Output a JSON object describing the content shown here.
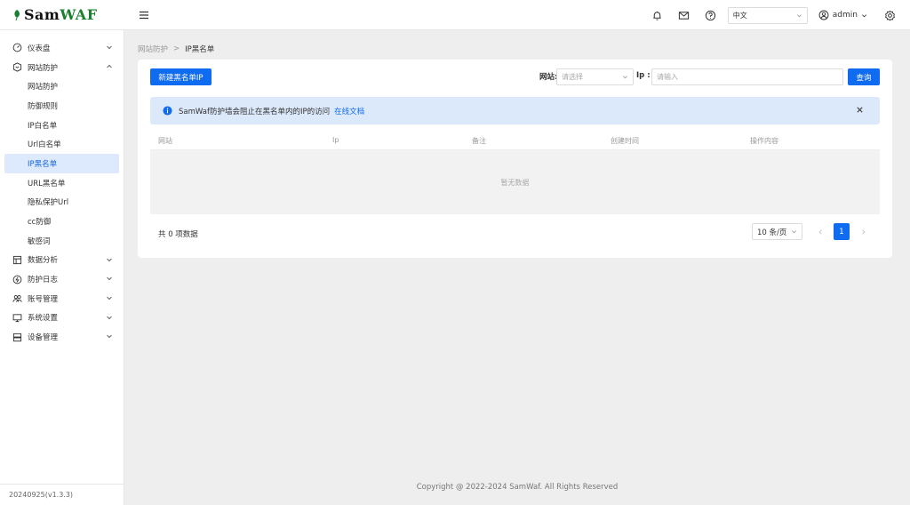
{
  "brand": {
    "name_part1": "Sam",
    "name_part2": "WAF"
  },
  "header": {
    "language": "中文",
    "user": "admin"
  },
  "sidebar": {
    "groups": [
      {
        "label": "仪表盘",
        "icon": "dashboard-icon"
      },
      {
        "label": "网站防护",
        "icon": "shield-icon"
      },
      {
        "label": "数据分析",
        "icon": "chart-icon"
      },
      {
        "label": "防护日志",
        "icon": "log-icon"
      },
      {
        "label": "账号管理",
        "icon": "users-icon"
      },
      {
        "label": "系统设置",
        "icon": "monitor-icon"
      },
      {
        "label": "设备管理",
        "icon": "server-icon"
      }
    ],
    "sub_items": [
      "网站防护",
      "防御规则",
      "IP白名单",
      "Url白名单",
      "IP黑名单",
      "URL黑名单",
      "隐私保护Url",
      "cc防御",
      "敏感词"
    ],
    "active_sub": "IP黑名单",
    "version": "20240925(v1.3.3)"
  },
  "breadcrumb": {
    "parent": "网站防护",
    "sep": ">",
    "current": "IP黑名单"
  },
  "toolbar": {
    "new_button": "新建黑名单IP",
    "site_label": "网站:",
    "site_placeholder": "请选择",
    "ip_label": "Ip :",
    "ip_placeholder": "请输入",
    "query_button": "查询"
  },
  "alert": {
    "message": "SamWaf防护墙会阻止在黑名单内的IP的访问",
    "link": "在线文档"
  },
  "table": {
    "columns": [
      "网站",
      "Ip",
      "备注",
      "创建时间",
      "操作内容"
    ],
    "empty_text": "暂无数据"
  },
  "pagination": {
    "total_text": "共 0 项数据",
    "page_size": "10 条/页",
    "current_page": "1"
  },
  "footer": {
    "copyright": "Copyright @ 2022-2024 SamWaf. All Rights Reserved"
  },
  "colors": {
    "primary": "#0f6bef",
    "brand_green": "#1a7f2e",
    "active_bg": "#dde9fc",
    "alert_bg": "#dce9fb"
  }
}
